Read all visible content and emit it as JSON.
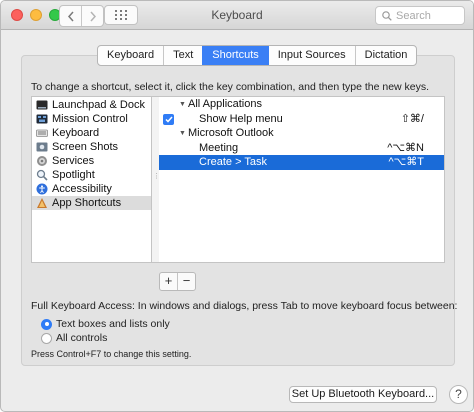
{
  "window": {
    "title": "Keyboard",
    "search_placeholder": "Search"
  },
  "toolbar": {
    "back_icon": "chevron-left-icon",
    "forward_icon": "chevron-right-icon",
    "grid_icon": "show-all-grid-icon"
  },
  "tabs": [
    {
      "label": "Keyboard",
      "active": false
    },
    {
      "label": "Text",
      "active": false
    },
    {
      "label": "Shortcuts",
      "active": true
    },
    {
      "label": "Input Sources",
      "active": false
    },
    {
      "label": "Dictation",
      "active": false
    }
  ],
  "instructions": "To change a shortcut, select it, click the key combination, and then type the new keys.",
  "categories": [
    {
      "label": "Launchpad & Dock",
      "icon": "launchpad-icon",
      "selected": false
    },
    {
      "label": "Mission Control",
      "icon": "mission-control-icon",
      "selected": false
    },
    {
      "label": "Keyboard",
      "icon": "keyboard-icon",
      "selected": false
    },
    {
      "label": "Screen Shots",
      "icon": "screenshot-icon",
      "selected": false
    },
    {
      "label": "Services",
      "icon": "gear-icon",
      "selected": false
    },
    {
      "label": "Spotlight",
      "icon": "spotlight-icon",
      "selected": false
    },
    {
      "label": "Accessibility",
      "icon": "accessibility-icon",
      "selected": false
    },
    {
      "label": "App Shortcuts",
      "icon": "app-shortcuts-icon",
      "selected": true
    }
  ],
  "shortcut_groups": {
    "all_apps": {
      "label": "All Applications"
    },
    "help_menu": {
      "label": "Show Help menu",
      "shortcut": "⇧⌘/",
      "checked": true
    },
    "outlook": {
      "label": "Microsoft Outlook"
    },
    "meeting": {
      "label": "Meeting",
      "shortcut": "^⌥⌘N"
    },
    "create_task": {
      "label": "Create > Task",
      "shortcut": "^⌥⌘T",
      "selected": true
    }
  },
  "list_controls": {
    "add": "+",
    "remove": "−"
  },
  "full_keyboard_access": {
    "label": "Full Keyboard Access: In windows and dialogs, press Tab to move keyboard focus between:",
    "options": [
      {
        "label": "Text boxes and lists only",
        "selected": true
      },
      {
        "label": "All controls",
        "selected": false
      }
    ],
    "note": "Press Control+F7 to change this setting."
  },
  "footer": {
    "bluetooth_button": "Set Up Bluetooth Keyboard...",
    "help_button": "?"
  },
  "colors": {
    "accent": "#3a7ff5",
    "selection": "#1a6bd8",
    "close": "#fc615d",
    "minimize": "#fdbc40",
    "zoom": "#34c84a"
  }
}
